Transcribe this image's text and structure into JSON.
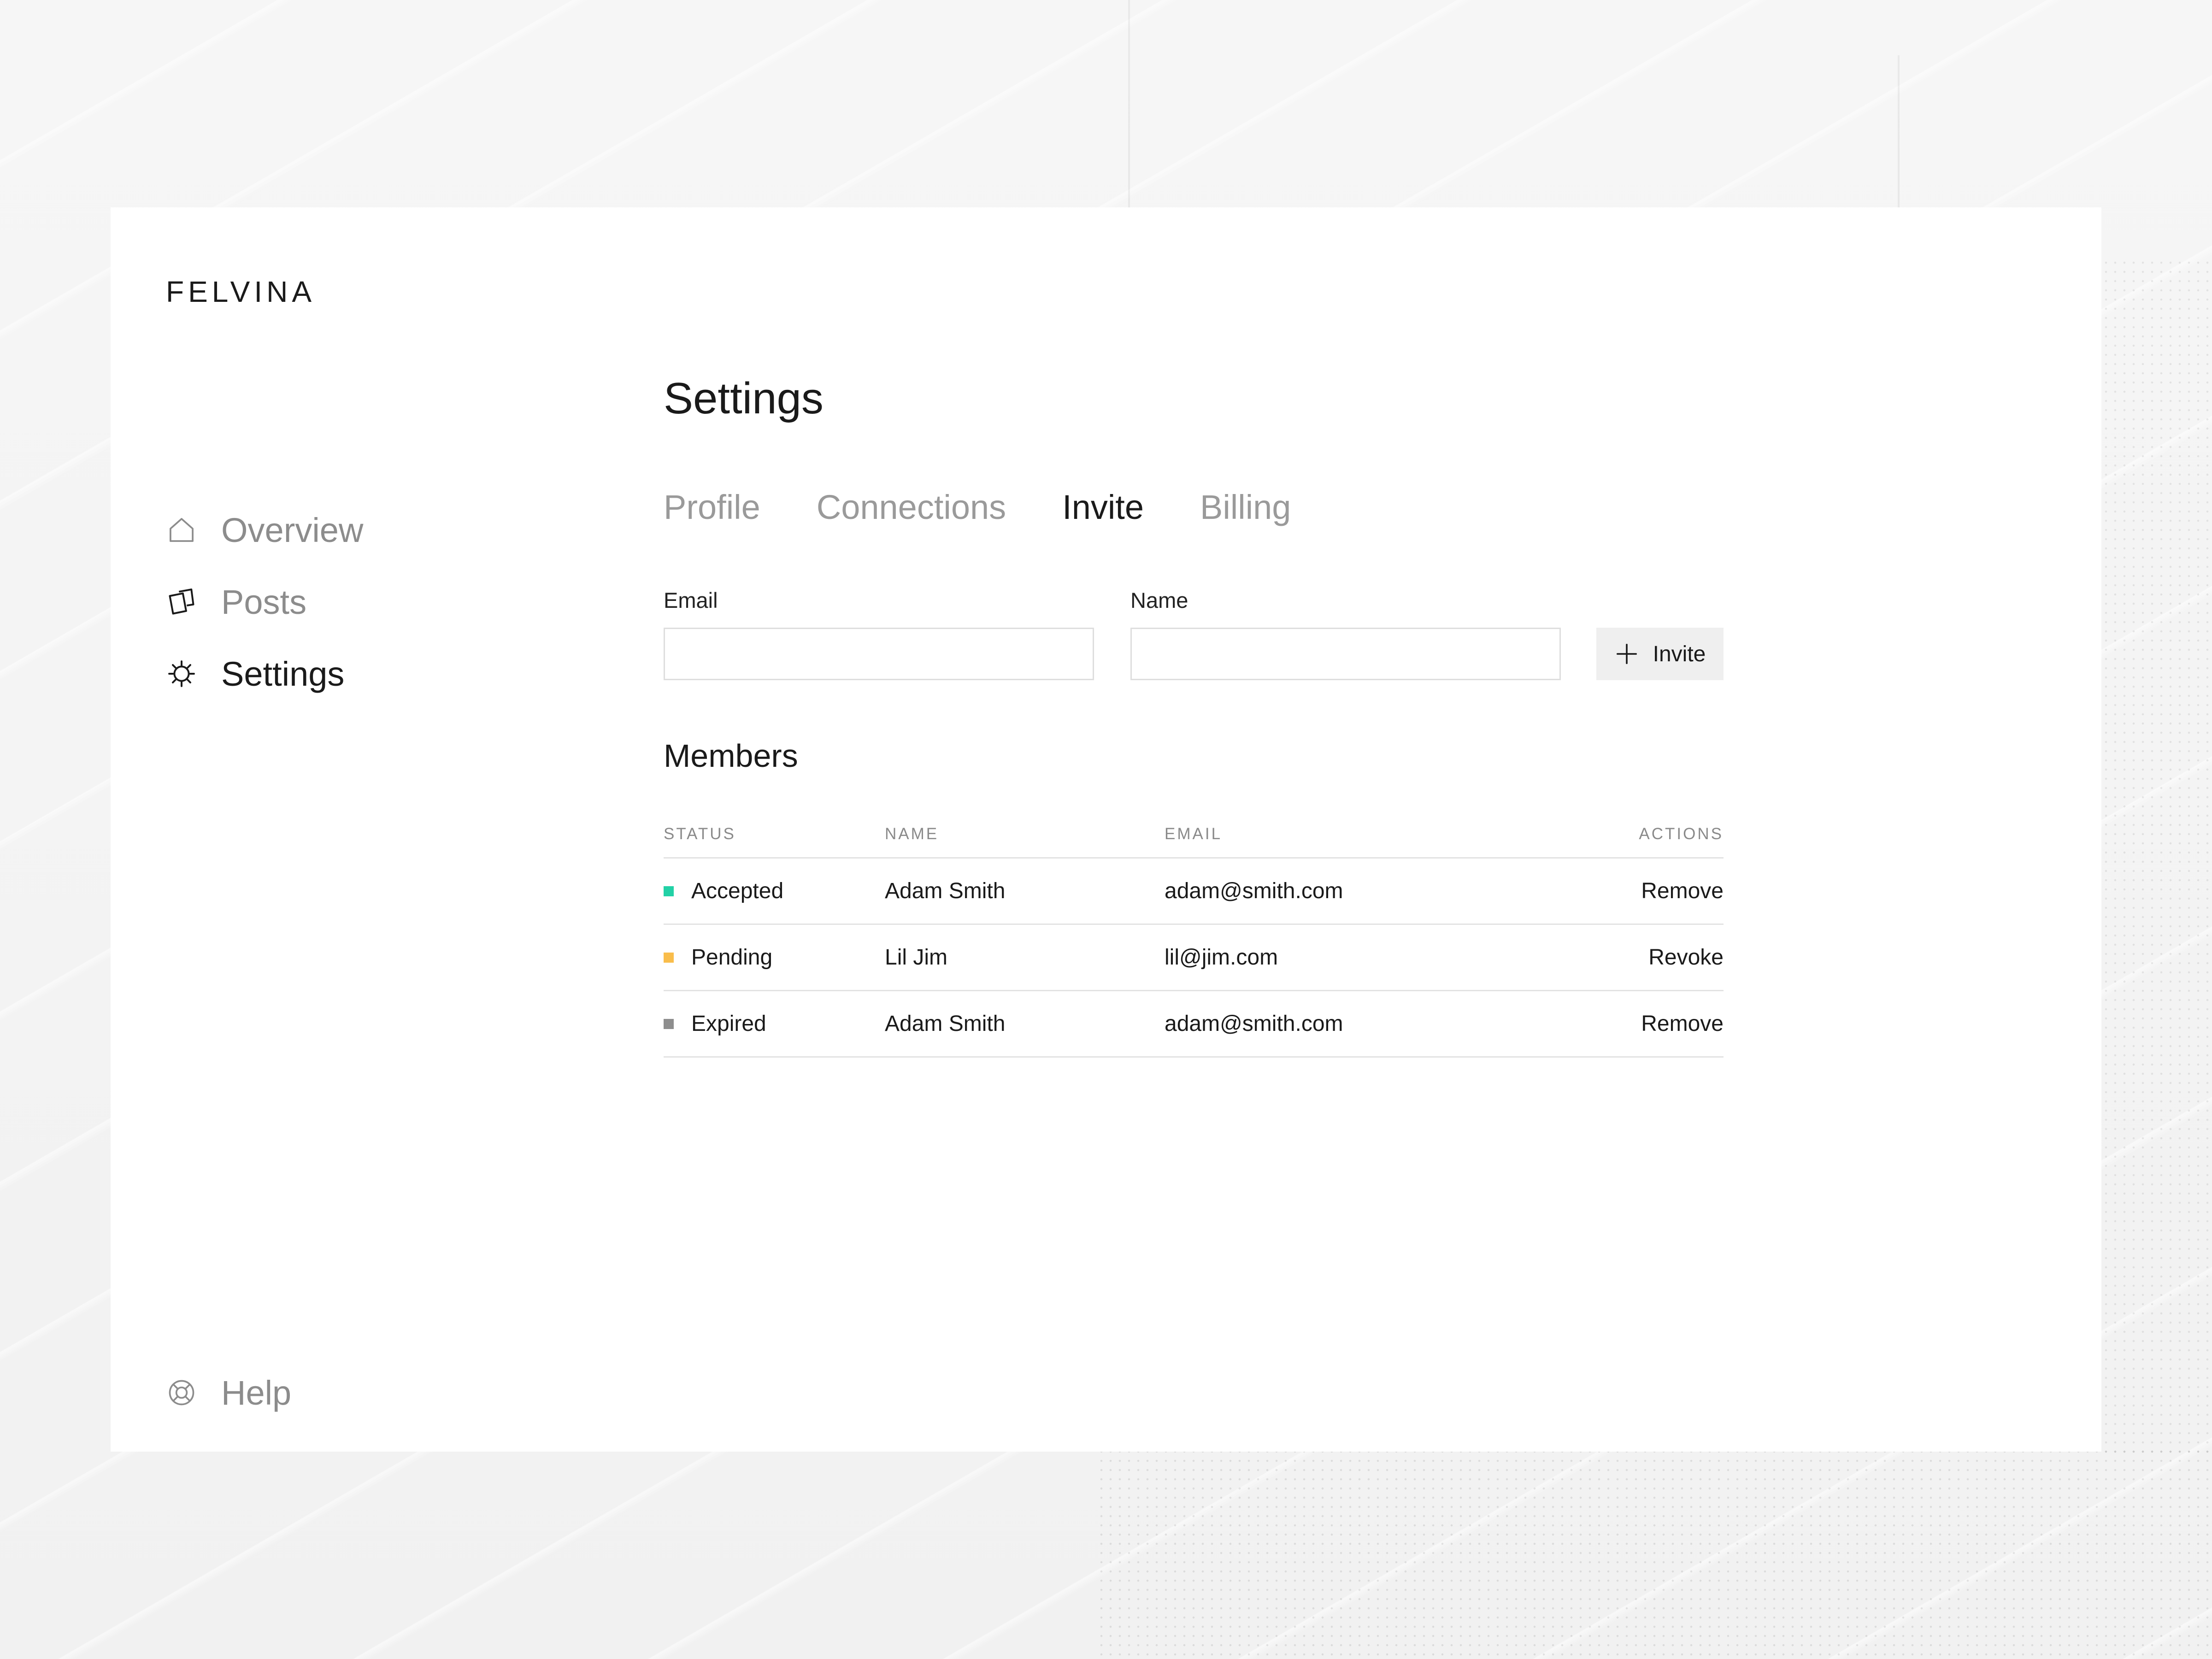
{
  "app": {
    "logo": "FELVINA"
  },
  "sidebar": {
    "items": [
      {
        "label": "Overview",
        "icon": "home-icon",
        "active": false
      },
      {
        "label": "Posts",
        "icon": "cards-icon",
        "active": false
      },
      {
        "label": "Settings",
        "icon": "gear-icon",
        "active": true
      }
    ],
    "help": {
      "label": "Help",
      "icon": "lifebuoy-icon"
    }
  },
  "main": {
    "title": "Settings",
    "tabs": [
      {
        "label": "Profile",
        "active": false
      },
      {
        "label": "Connections",
        "active": false
      },
      {
        "label": "Invite",
        "active": true
      },
      {
        "label": "Billing",
        "active": false
      }
    ],
    "form": {
      "email_label": "Email",
      "email_value": "",
      "email_placeholder": "",
      "name_label": "Name",
      "name_value": "",
      "name_placeholder": "",
      "invite_label": "Invite",
      "invite_icon": "plus-icon"
    },
    "members": {
      "title": "Members",
      "columns": [
        "STATUS",
        "NAME",
        "EMAIL",
        "ACTIONS"
      ],
      "rows": [
        {
          "status": "Accepted",
          "status_color": "#22d1a6",
          "name": "Adam Smith",
          "email": "adam@smith.com",
          "action": "Remove"
        },
        {
          "status": "Pending",
          "status_color": "#f9bd4b",
          "name": "Lil Jim",
          "email": "lil@jim.com",
          "action": "Revoke"
        },
        {
          "status": "Expired",
          "status_color": "#8e8e8e",
          "name": "Adam Smith",
          "email": "adam@smith.com",
          "action": "Remove"
        }
      ]
    }
  }
}
